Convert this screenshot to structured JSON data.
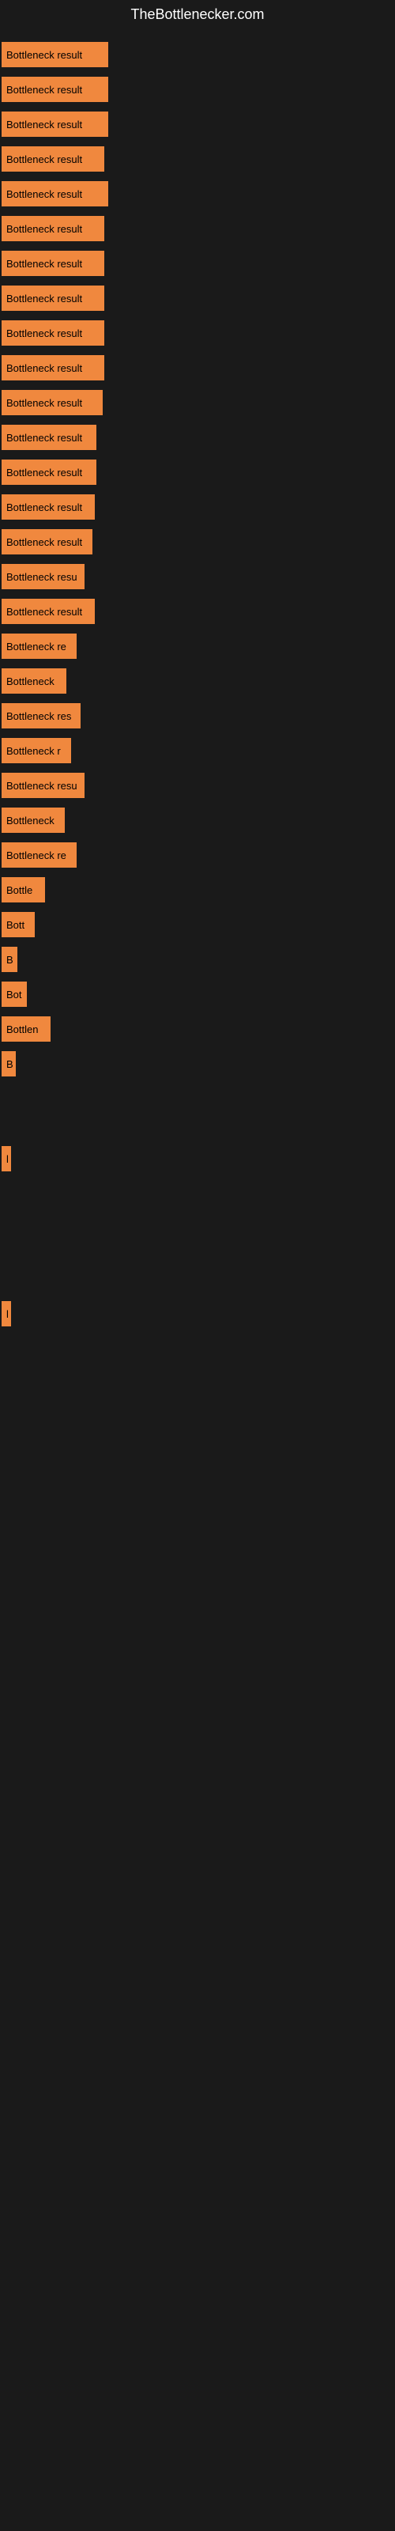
{
  "site": {
    "title": "TheBottlenecker.com"
  },
  "bars": [
    {
      "label": "Bottleneck result",
      "width": 135
    },
    {
      "label": "Bottleneck result",
      "width": 135
    },
    {
      "label": "Bottleneck result",
      "width": 135
    },
    {
      "label": "Bottleneck result",
      "width": 130
    },
    {
      "label": "Bottleneck result",
      "width": 135
    },
    {
      "label": "Bottleneck result",
      "width": 130
    },
    {
      "label": "Bottleneck result",
      "width": 130
    },
    {
      "label": "Bottleneck result",
      "width": 130
    },
    {
      "label": "Bottleneck result",
      "width": 130
    },
    {
      "label": "Bottleneck result",
      "width": 130
    },
    {
      "label": "Bottleneck result",
      "width": 128
    },
    {
      "label": "Bottleneck result",
      "width": 120
    },
    {
      "label": "Bottleneck result",
      "width": 120
    },
    {
      "label": "Bottleneck result",
      "width": 118
    },
    {
      "label": "Bottleneck result",
      "width": 115
    },
    {
      "label": "Bottleneck resu",
      "width": 105
    },
    {
      "label": "Bottleneck result",
      "width": 118
    },
    {
      "label": "Bottleneck re",
      "width": 95
    },
    {
      "label": "Bottleneck",
      "width": 82
    },
    {
      "label": "Bottleneck res",
      "width": 100
    },
    {
      "label": "Bottleneck r",
      "width": 88
    },
    {
      "label": "Bottleneck resu",
      "width": 105
    },
    {
      "label": "Bottleneck",
      "width": 80
    },
    {
      "label": "Bottleneck re",
      "width": 95
    },
    {
      "label": "Bottle",
      "width": 55
    },
    {
      "label": "Bott",
      "width": 42
    },
    {
      "label": "B",
      "width": 20
    },
    {
      "label": "Bot",
      "width": 32
    },
    {
      "label": "Bottlen",
      "width": 62
    },
    {
      "label": "B",
      "width": 18
    },
    {
      "label": "",
      "width": 0
    },
    {
      "label": "",
      "width": 0
    },
    {
      "label": "l",
      "width": 8
    },
    {
      "label": "",
      "width": 0
    },
    {
      "label": "",
      "width": 0
    },
    {
      "label": "",
      "width": 0
    },
    {
      "label": "",
      "width": 0
    },
    {
      "label": "l",
      "width": 8
    }
  ]
}
